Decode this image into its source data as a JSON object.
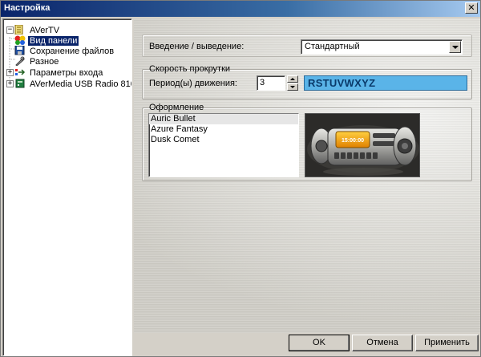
{
  "window": {
    "title": "Настройка",
    "close_glyph": "✕"
  },
  "tree": {
    "items": [
      {
        "label": "AVerTV",
        "icon": "app-icon",
        "expander": "−"
      },
      {
        "label": "Вид панели",
        "icon": "panel-view-icon",
        "selected": true
      },
      {
        "label": "Сохранение файлов",
        "icon": "floppy-disk-icon"
      },
      {
        "label": "Разное",
        "icon": "wrench-icon"
      },
      {
        "label": "Параметры входа",
        "icon": "input-icon",
        "expander": "+"
      },
      {
        "label": "AVerMedia USB Radio 810",
        "icon": "device-icon",
        "expander": "+"
      }
    ]
  },
  "settings": {
    "fade_label": "Введение / выведение:",
    "fade_value": "Стандартный",
    "scroll_group_title": "Скорость прокрутки",
    "period_label": "Период(ы) движения:",
    "period_value": "3",
    "scroll_preview_text": "RSTUVWXYZ",
    "appearance_group_title": "Оформление",
    "skins": [
      "Auric Bullet",
      "Azure Fantasy",
      "Dusk Comet"
    ],
    "selected_skin": "Auric Bullet",
    "skin_display_time": "15:00:00"
  },
  "buttons": {
    "ok": "OK",
    "cancel": "Отмена",
    "apply": "Применить"
  },
  "colors": {
    "title_bar": "#0a246a",
    "tree_selection": "#0a246a",
    "scroll_preview_bg": "#5ab4e8",
    "skin_display": "#f5a000"
  }
}
